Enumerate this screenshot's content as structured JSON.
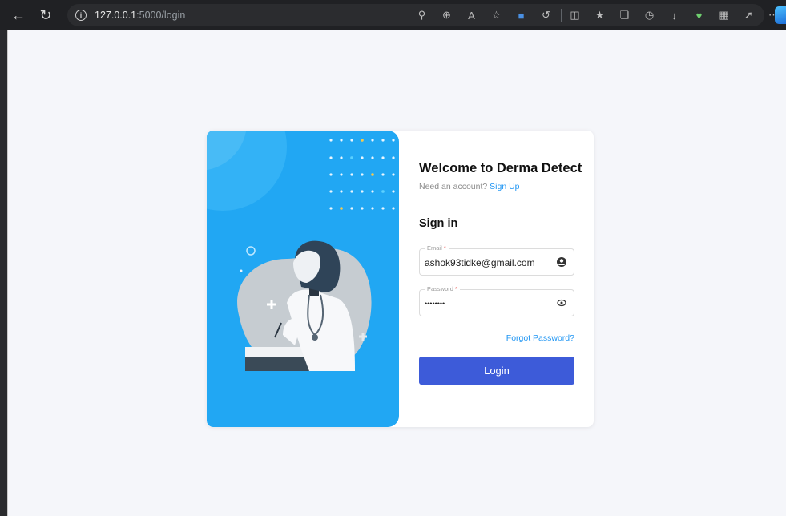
{
  "browser": {
    "url_host": "127.0.0.1",
    "url_path": ":5000/login"
  },
  "card": {
    "title": "Welcome to Derma Detect",
    "need_account": "Need an account?",
    "signup_link": "Sign Up",
    "signin_heading": "Sign in",
    "email": {
      "label": "Email",
      "required_mark": "*",
      "value": "ashok93tidke@gmail.com"
    },
    "password": {
      "label": "Password",
      "required_mark": "*",
      "value": "••••••••"
    },
    "forgot_link": "Forgot Password?",
    "login_button": "Login"
  },
  "colors": {
    "accent_blue": "#21a7f3",
    "button_blue": "#3d5bd9",
    "link_blue": "#2196f3"
  }
}
